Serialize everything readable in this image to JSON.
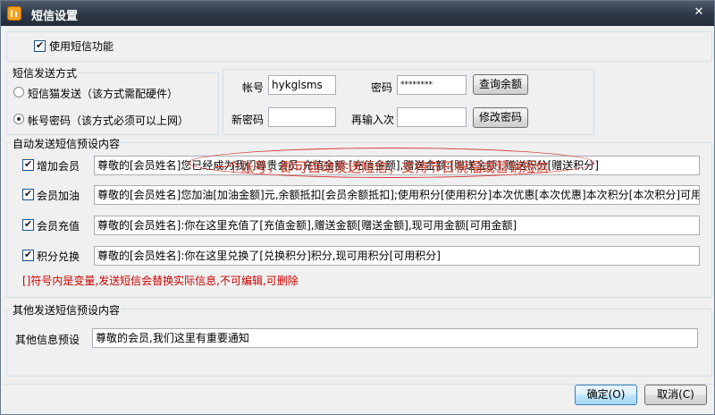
{
  "window": {
    "title": "短信设置",
    "close_glyph": "✕"
  },
  "enable_sms": {
    "label": "使用短信功能",
    "checked": true
  },
  "send_method": {
    "group_label": "短信发送方式",
    "options": [
      {
        "label": "短信猫发送（该方式需配硬件）",
        "selected": false
      },
      {
        "label": "帐号密码（该方式必须可以上网）",
        "selected": true
      }
    ]
  },
  "account": {
    "account_label": "帐号",
    "account_value": "hykglsms",
    "password_label": "密码",
    "password_value": "********",
    "query_balance_label": "查询余额",
    "new_password_label": "新密码",
    "new_password_value": "",
    "confirm_label": "再输入次",
    "confirm_value": "",
    "change_password_label": "修改密码"
  },
  "callout": {
    "text": "一个账号，即可自动发送短信；支持节日祝福或营销短信"
  },
  "auto_group": {
    "group_label": "自动发送短信预设内容",
    "items": [
      {
        "label": "增加会员",
        "checked": true,
        "text": "尊敬的[会员姓名]您已经成为我们尊贵会员,充值金额:[充值金额],赠送金额:[赠送金额],赠送积分[赠送积分]"
      },
      {
        "label": "会员加油",
        "checked": true,
        "text": "尊敬的[会员姓名]您加油[加油金额]元,余额抵扣[会员余额抵扣];使用积分[使用积分]本次优惠[本次优惠]本次积分[本次积分]可用金"
      },
      {
        "label": "会员充值",
        "checked": true,
        "text": "尊敬的[会员姓名]:你在这里充值了[充值金额],赠送金额[赠送金额],现可用金额[可用金额]"
      },
      {
        "label": "积分兑换",
        "checked": true,
        "text": "尊敬的[会员姓名]:你在这里兑换了[兑换积分]积分,现可用积分[可用积分]"
      }
    ],
    "note": "[]符号内是变量,发送短信会替换实际信息,不可编辑,可删除"
  },
  "other_group": {
    "group_label": "其他发送短信预设内容",
    "label": "其他信息预设",
    "text": "尊敬的会员,我们这里有重要通知"
  },
  "footer": {
    "ok_label": "确定(O)",
    "cancel_label": "取消(C)"
  }
}
